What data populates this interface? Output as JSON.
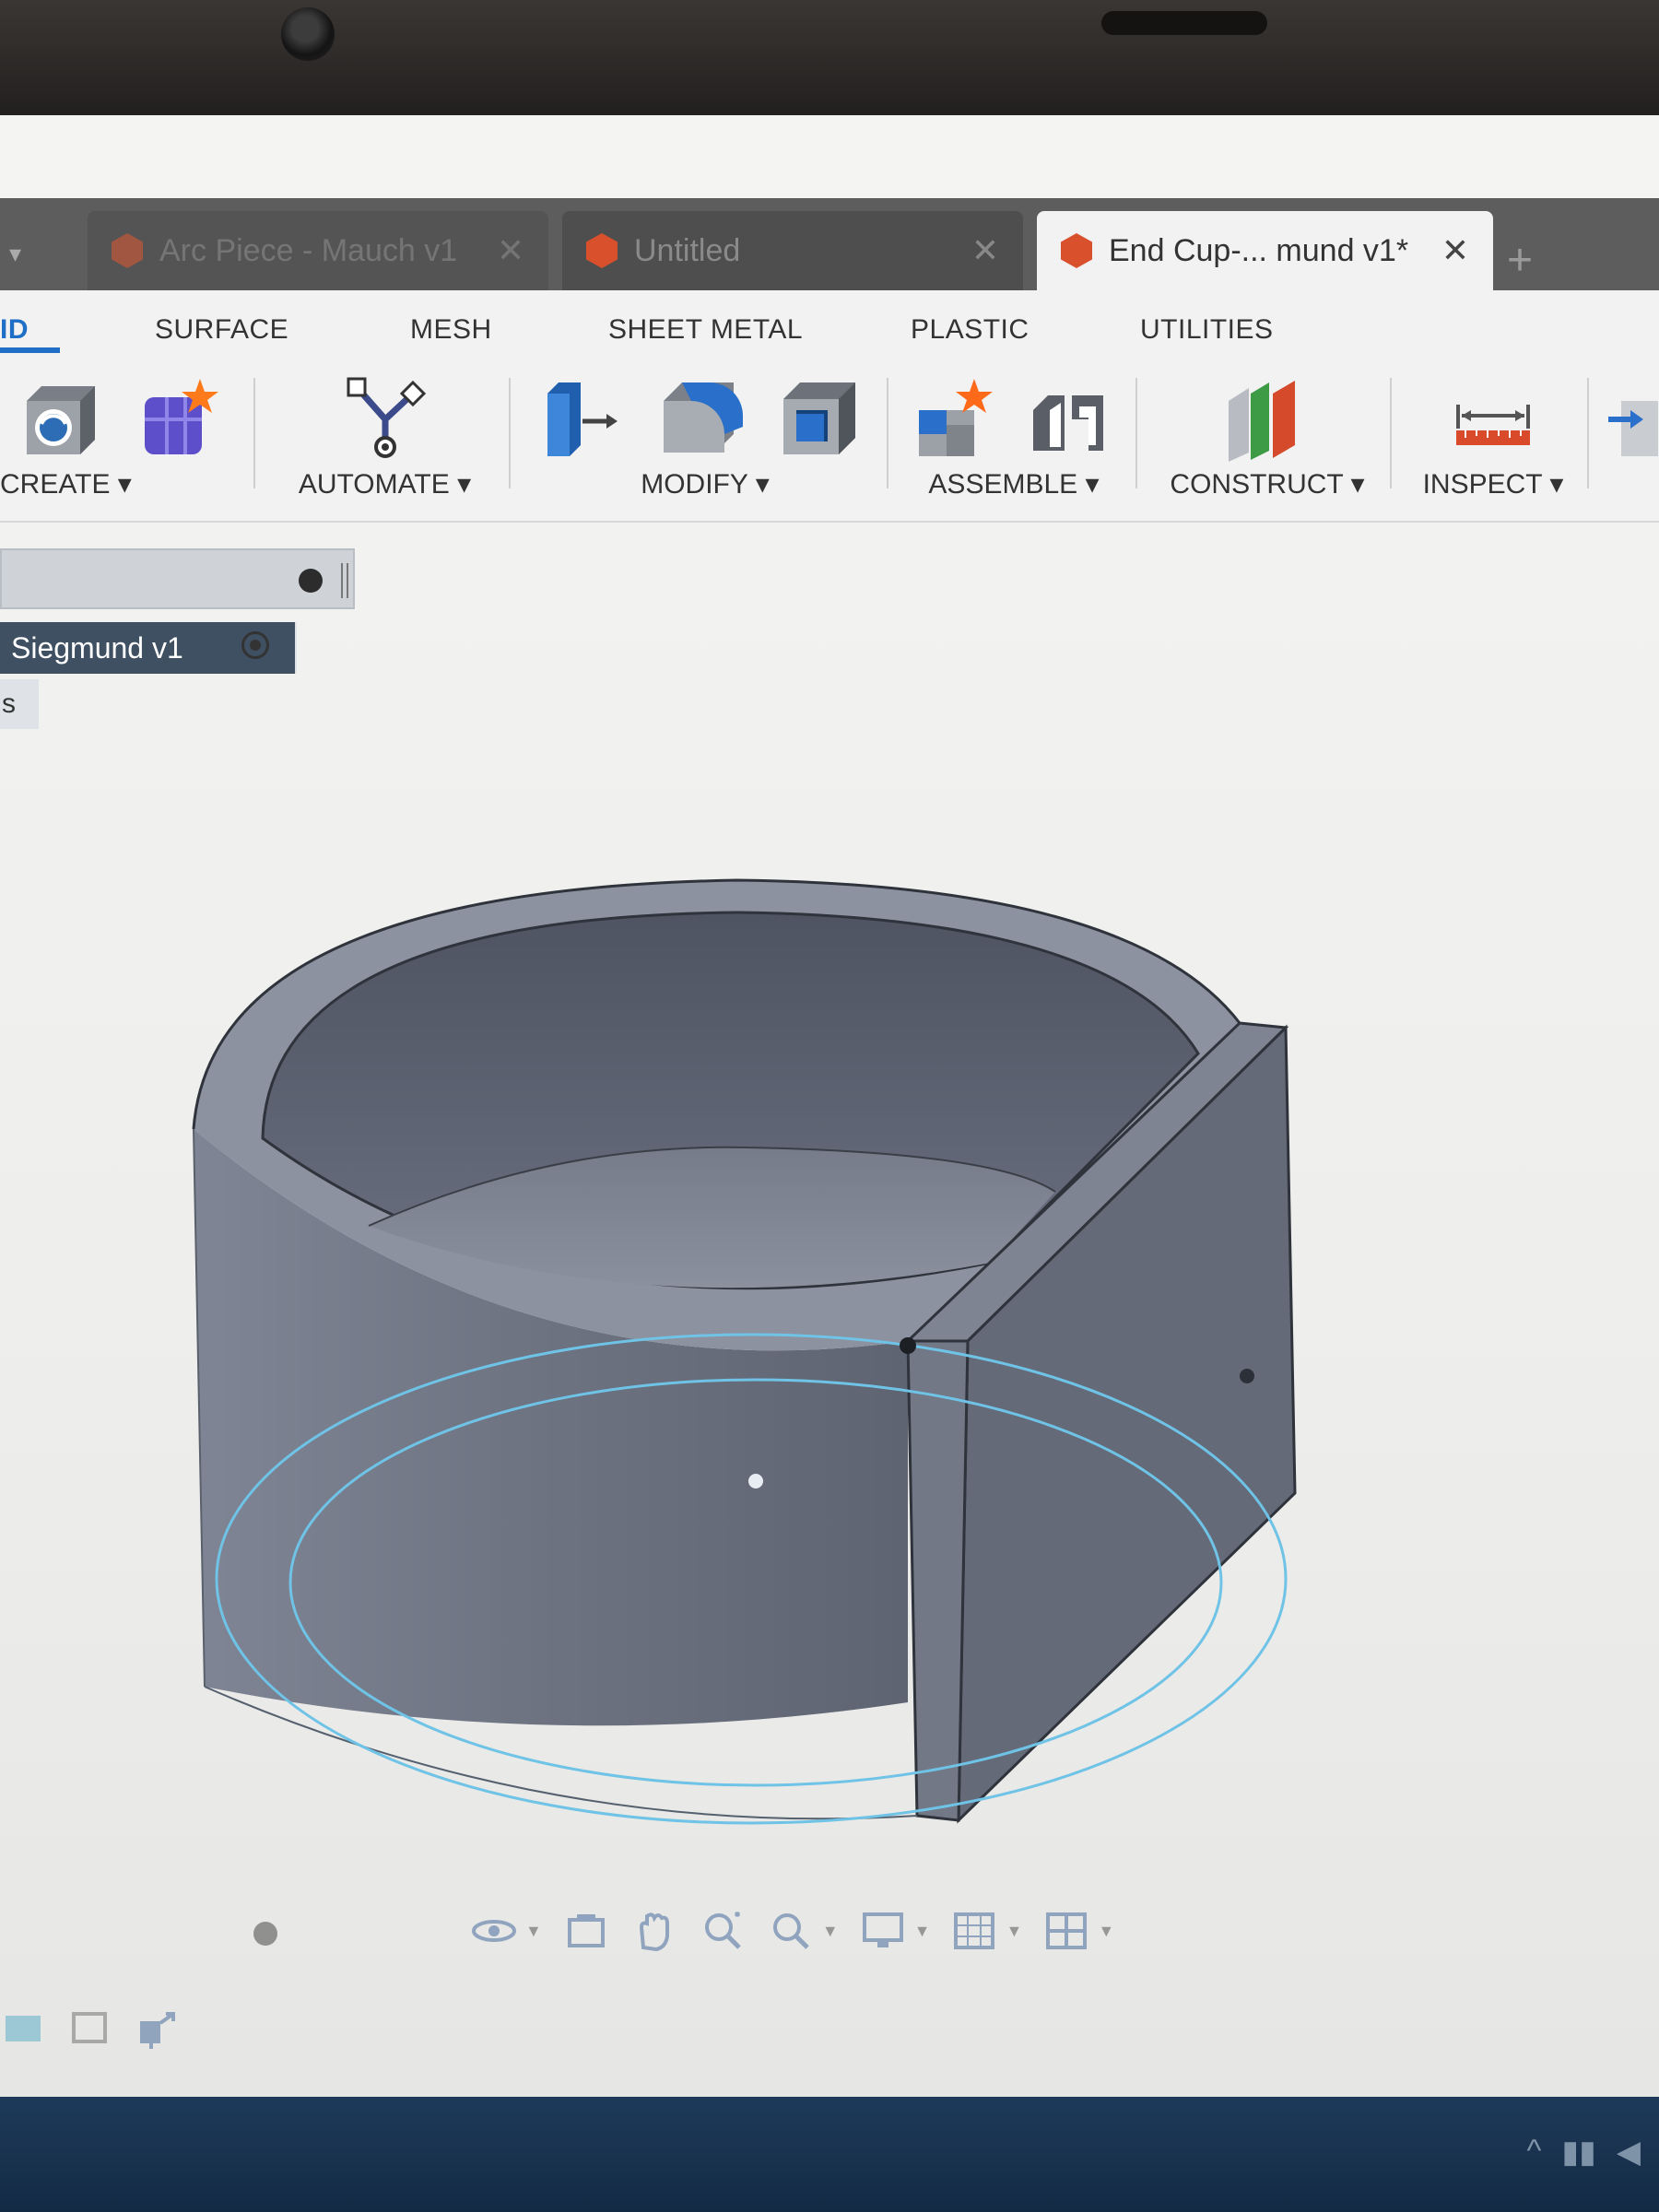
{
  "tabs": [
    {
      "label": "Arc Piece - Mauch v1",
      "active": false
    },
    {
      "label": "Untitled",
      "active": false
    },
    {
      "label": "End Cup-... mund v1*",
      "active": true
    }
  ],
  "tab_close_glyph": "✕",
  "new_tab_glyph": "+",
  "categories": [
    "ID",
    "SURFACE",
    "MESH",
    "SHEET METAL",
    "PLASTIC",
    "UTILITIES"
  ],
  "groups": {
    "create": "CREATE ▾",
    "automate": "AUTOMATE ▾",
    "modify": "MODIFY ▾",
    "assemble": "ASSEMBLE ▾",
    "construct": "CONSTRUCT ▾",
    "inspect": "INSPECT ▾"
  },
  "browser": {
    "root_node": "Siegmund v1",
    "sub_node": "s"
  },
  "icons": {
    "create": [
      "new-component-icon",
      "create-form-icon"
    ],
    "automate": [
      "automate-icon"
    ],
    "modify": [
      "press-pull-icon",
      "fillet-icon",
      "shell-icon"
    ],
    "assemble": [
      "new-component-assemble-icon",
      "joint-icon"
    ],
    "construct": [
      "construct-plane-icon"
    ],
    "inspect": [
      "measure-icon"
    ],
    "navbar": [
      "orbit-icon",
      "look-at-icon",
      "pan-icon",
      "zoom-icon",
      "fit-icon",
      "display-settings-icon",
      "grid-icon",
      "viewports-icon"
    ],
    "timeline": [
      "sketch-icon",
      "plane-icon",
      "extrude-icon"
    ]
  },
  "colors": {
    "accent": "#1f6fc7",
    "tab_hex": "#d9512c",
    "body_shade": "#6e7482",
    "sketch_line": "#6fc3e6",
    "taskbar": "#1e3a5a"
  }
}
